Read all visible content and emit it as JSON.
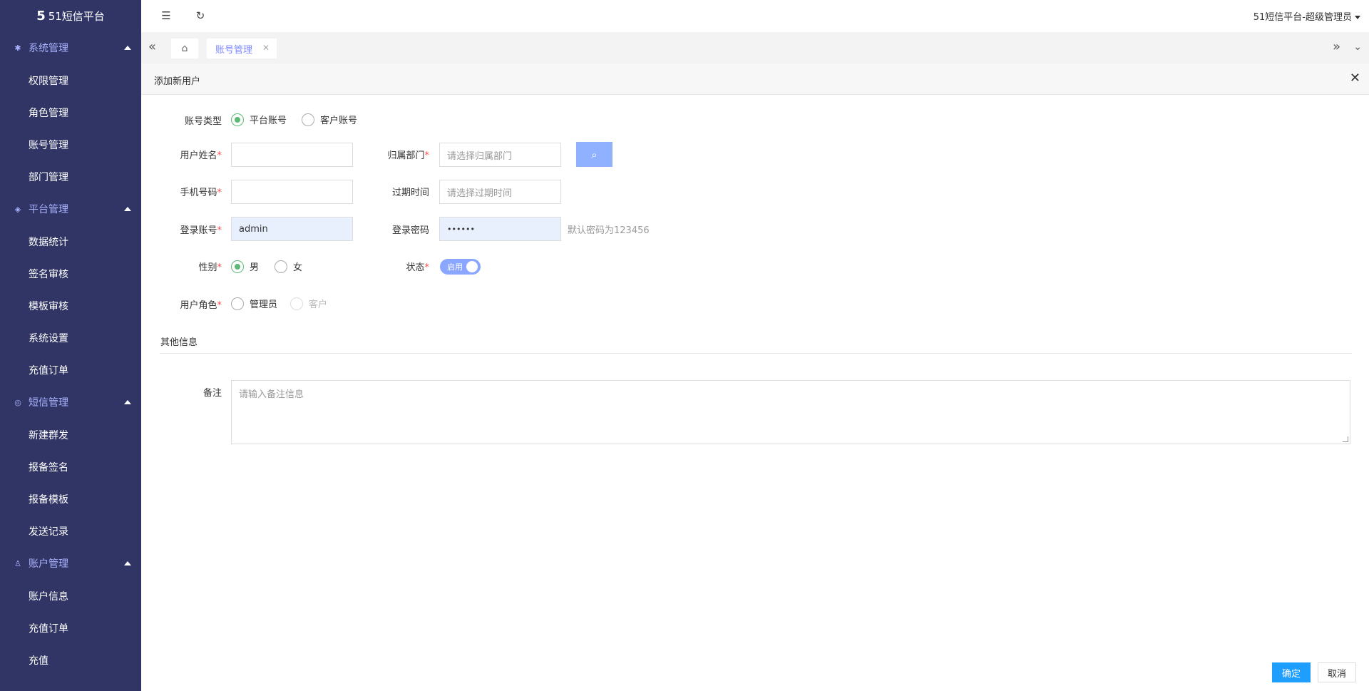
{
  "app": {
    "logo_mark": "5",
    "logo_title": "51短信平台"
  },
  "sidebar": {
    "groups": [
      {
        "label": "系统管理",
        "icon": "gear-icon",
        "items": [
          "权限管理",
          "角色管理",
          "账号管理",
          "部门管理"
        ]
      },
      {
        "label": "平台管理",
        "icon": "layers-icon",
        "items": [
          "数据统计",
          "签名审核",
          "模板审核",
          "系统设置",
          "充值订单"
        ]
      },
      {
        "label": "短信管理",
        "icon": "message-icon",
        "items": [
          "新建群发",
          "报备签名",
          "报备模板",
          "发送记录"
        ]
      },
      {
        "label": "账户管理",
        "icon": "user-icon",
        "items": [
          "账户信息",
          "充值订单",
          "充值"
        ]
      }
    ]
  },
  "header": {
    "user_label": "51短信平台-超级管理员"
  },
  "tabs": {
    "active": "账号管理"
  },
  "panel": {
    "title": "添加新用户"
  },
  "form": {
    "account_type": {
      "label": "账号类型",
      "options": [
        "平台账号",
        "客户账号"
      ],
      "selected": "平台账号"
    },
    "name": {
      "label": "用户姓名",
      "value": ""
    },
    "department": {
      "label": "归属部门",
      "placeholder": "请选择归属部门"
    },
    "phone": {
      "label": "手机号码",
      "value": ""
    },
    "expire": {
      "label": "过期时间",
      "placeholder": "请选择过期时间"
    },
    "login": {
      "label": "登录账号",
      "value": "admin"
    },
    "password": {
      "label": "登录密码",
      "value": "••••••",
      "hint": "默认密码为123456"
    },
    "gender": {
      "label": "性别",
      "options": [
        "男",
        "女"
      ],
      "selected": "男"
    },
    "status": {
      "label": "状态",
      "switch_text": "启用",
      "on": true
    },
    "role": {
      "label": "用户角色",
      "options": [
        "管理员",
        "客户"
      ]
    },
    "other_section": "其他信息",
    "remark": {
      "label": "备注",
      "placeholder": "请输入备注信息"
    }
  },
  "actions": {
    "ok": "确定",
    "cancel": "取消"
  },
  "colors": {
    "sidebar_bg": "#313565",
    "accent": "#1e9fff",
    "radio_on": "#5fb878",
    "group_text": "#a9b3ff"
  }
}
